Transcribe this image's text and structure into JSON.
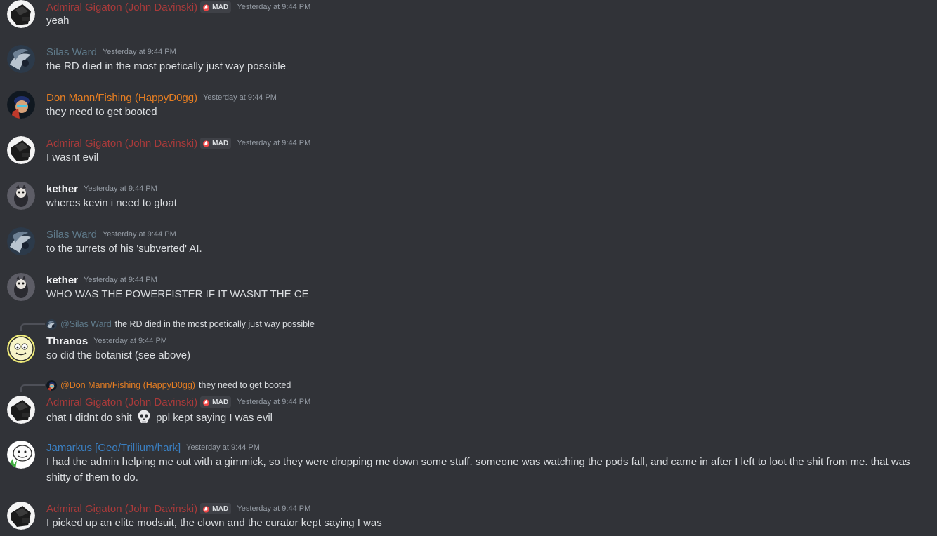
{
  "tag_label": "MAD",
  "colors": {
    "background": "#313338",
    "admiral": "#a93a3a",
    "silas": "#5f7a8a",
    "don": "#e67e22",
    "jamarkus": "#3a7fc1",
    "timestamp": "#949ba4"
  },
  "messages": [
    {
      "author": "Admiral Gigaton (John Davinski)",
      "time": "Yesterday at 9:44 PM",
      "text": "yeah"
    },
    {
      "author": "Silas Ward",
      "time": "Yesterday at 9:44 PM",
      "text": "the RD died in the most poetically just way possible"
    },
    {
      "author": "Don Mann/Fishing (HappyD0gg)",
      "time": "Yesterday at 9:44 PM",
      "text": "they need to get booted"
    },
    {
      "author": "Admiral Gigaton (John Davinski)",
      "time": "Yesterday at 9:44 PM",
      "text": "I wasnt evil"
    },
    {
      "author": "kether",
      "time": "Yesterday at 9:44 PM",
      "text": "wheres kevin i need to gloat"
    },
    {
      "author": "Silas Ward",
      "time": "Yesterday at 9:44 PM",
      "text": "to the turrets of his 'subverted' AI."
    },
    {
      "author": "kether",
      "time": "Yesterday at 9:44 PM",
      "text": "WHO WAS THE POWERFISTER IF IT WASNT THE CE"
    },
    {
      "author": "Thranos",
      "time": "Yesterday at 9:44 PM",
      "text": "so did the botanist (see above)",
      "reply": {
        "name": "@Silas Ward",
        "text": "the RD died in the most poetically just way possible"
      }
    },
    {
      "author": "Admiral Gigaton (John Davinski)",
      "time": "Yesterday at 9:44 PM",
      "text_a": "chat I didnt do shit",
      "emoji": "skull-emoji",
      "text_b": "ppl kept saying I was evil",
      "reply": {
        "name": "@Don Mann/Fishing (HappyD0gg)",
        "text": "they need to get booted"
      }
    },
    {
      "author": "Jamarkus [Geo/Trillium/hark]",
      "time": "Yesterday at 9:44 PM",
      "text": "I had the admin helping me out with a gimmick, so they were dropping me down some stuff. someone was watching the pods fall, and came in after I left to loot the shit from me. that was shitty of them to do."
    },
    {
      "author": "Admiral Gigaton (John Davinski)",
      "time": "Yesterday at 9:44 PM",
      "text": "I picked up an elite modsuit, the clown and the curator kept saying I was"
    }
  ]
}
